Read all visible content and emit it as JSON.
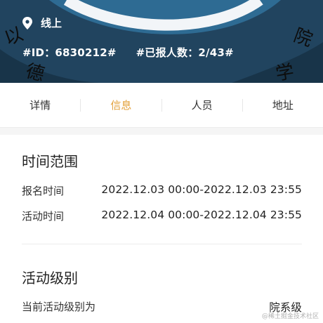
{
  "banner": {
    "location": "线上",
    "id_text": "#ID：6830212#",
    "signup_text": "#已报人数：2/43#"
  },
  "tabs": [
    {
      "label": "详情",
      "active": false
    },
    {
      "label": "信息",
      "active": true
    },
    {
      "label": "人员",
      "active": false
    },
    {
      "label": "地址",
      "active": false
    }
  ],
  "time_range": {
    "title": "时间范围",
    "signup_label": "报名时间",
    "signup_value": "2022.12.03 00:00-2022.12.03 23:55",
    "activity_label": "活动时间",
    "activity_value": "2022.12.04 00:00-2022.12.04 23:55"
  },
  "level": {
    "title": "活动级别",
    "label": "当前活动级别为",
    "value": "院系级"
  },
  "watermark": "@稀土掘金技术社区",
  "colors": {
    "accent": "#e3a13b",
    "banner_bg": "#1e3f5a"
  }
}
